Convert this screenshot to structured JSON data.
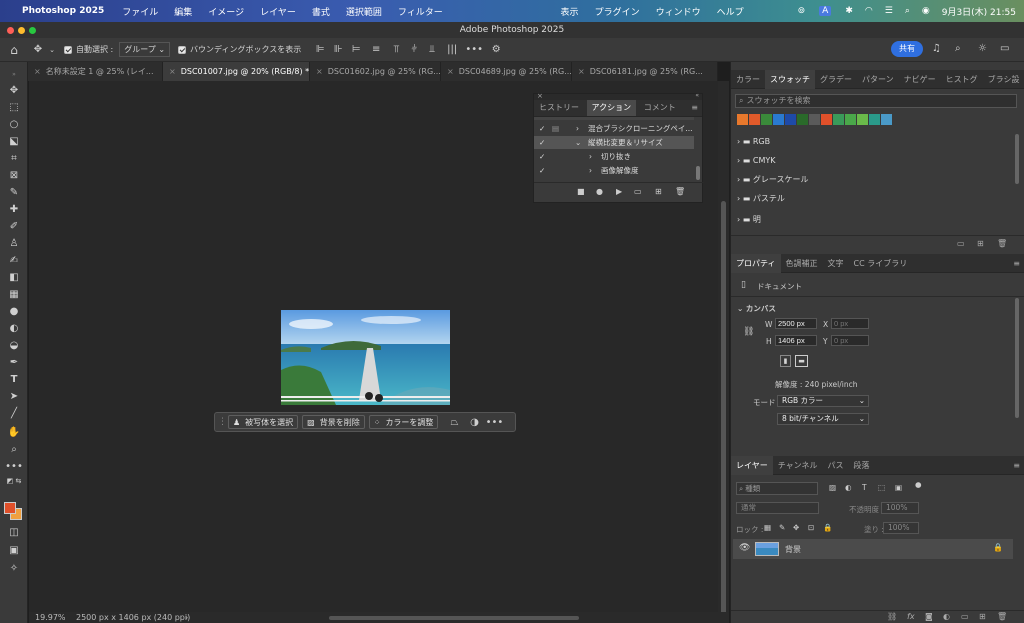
{
  "menubar": {
    "app_name": "Photoshop 2025",
    "items": [
      "ファイル",
      "編集",
      "イメージ",
      "レイヤー",
      "書式",
      "選択範囲",
      "フィルター"
    ],
    "right_items": [
      "表示",
      "プラグイン",
      "ウィンドウ",
      "ヘルプ"
    ],
    "input_indicator": "A",
    "clock": "9月3日(木)  21:55"
  },
  "window": {
    "title": "Adobe Photoshop 2025"
  },
  "options": {
    "auto_select_label": "自動選択 :",
    "auto_select_value": "グループ",
    "bbox_label": "バウンディングボックスを表示",
    "share_label": "共有"
  },
  "doc_tabs": [
    {
      "label": "名称未設定 1 @ 25% (レイ..."
    },
    {
      "label": "DSC01007.jpg @ 20% (RGB/8) *"
    },
    {
      "label": "DSC01602.jpg @ 25% (RG..."
    },
    {
      "label": "DSC04689.jpg @ 25% (RG..."
    },
    {
      "label": "DSC06181.jpg @ 25% (RG..."
    }
  ],
  "actions_panel": {
    "tabs": [
      "ヒストリー",
      "アクション",
      "コメント"
    ],
    "rows": [
      {
        "label": "混合ブラシクローニングペイ..."
      },
      {
        "label": "縦横比変更＆リサイズ"
      },
      {
        "label": "切り抜き"
      },
      {
        "label": "画像解像度"
      }
    ]
  },
  "context_bar": {
    "select_subject": "被写体を選択",
    "remove_bg": "背景を削除",
    "adjust_color": "カラーを調整"
  },
  "status": {
    "zoom": "19.97%",
    "doc_info": "2500 px x 1406 px (240 ppi)"
  },
  "swatches_panel": {
    "tabs": [
      "カラー",
      "スウォッチ",
      "グラデー",
      "パターン",
      "ナビゲー",
      "ヒストグ",
      "ブラシ設"
    ],
    "search_placeholder": "スウォッチを検索",
    "colors": [
      "#e8782c",
      "#e05a2a",
      "#3a8a3a",
      "#2a7ad0",
      "#1e4aa8",
      "#2a6a2a",
      "#5a5a5a",
      "#e0502a",
      "#3a9a5a",
      "#4aa84a",
      "#6aba4a",
      "#2a9a8a",
      "#4a9ac8"
    ],
    "folders": [
      "RGB",
      "CMYK",
      "グレースケール",
      "パステル",
      "明"
    ]
  },
  "properties_panel": {
    "tabs": [
      "プロパティ",
      "色調補正",
      "文字",
      "CC ライブラリ"
    ],
    "doc_label": "ドキュメント",
    "section": "カンバス",
    "w_label": "W",
    "w_value": "2500 px",
    "h_label": "H",
    "h_value": "1406 px",
    "x_label": "X",
    "x_placeholder": "0 px",
    "y_label": "Y",
    "y_placeholder": "0 px",
    "resolution": "解像度 : 240 pixel/inch",
    "mode_label": "モード",
    "mode_value": "RGB カラー",
    "depth_value": "8 bit/チャンネル"
  },
  "layers_panel": {
    "tabs": [
      "レイヤー",
      "チャンネル",
      "パス",
      "段落"
    ],
    "filter_placeholder": "種類",
    "blend_mode": "通常",
    "opacity_label": "不透明度 :",
    "opacity_value": "100%",
    "lock_label": "ロック :",
    "fill_label": "塗り :",
    "fill_value": "100%",
    "layer_name": "背景"
  }
}
